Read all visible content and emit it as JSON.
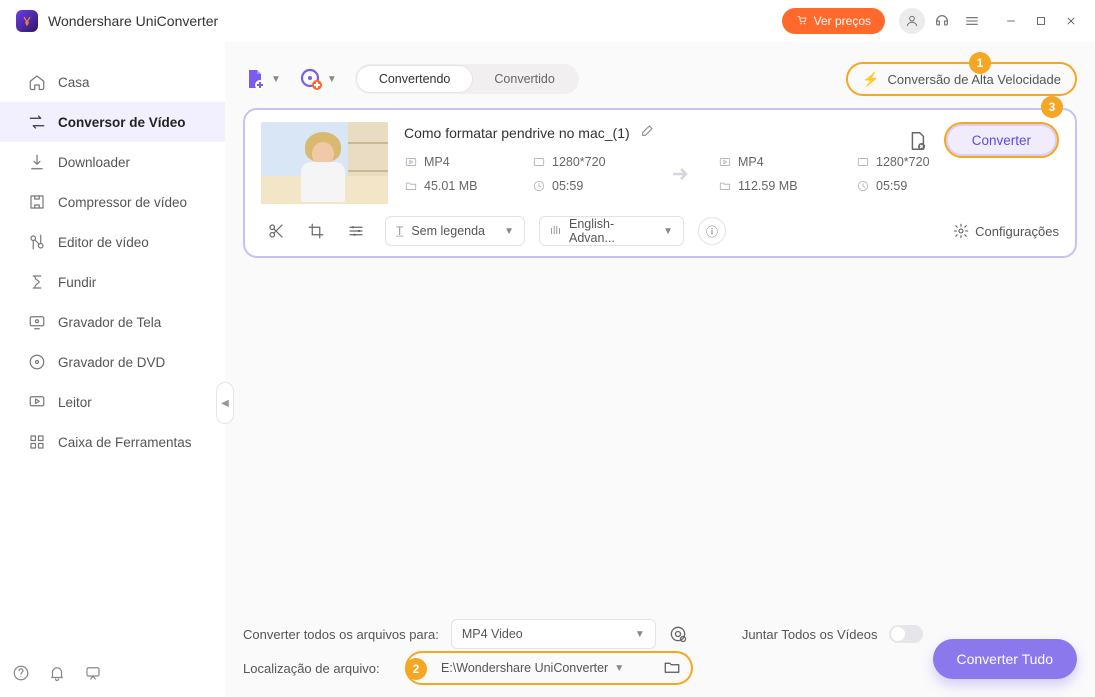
{
  "titlebar": {
    "app_name": "Wondershare UniConverter",
    "price_button": "Ver preços"
  },
  "sidebar": {
    "items": [
      {
        "label": "Casa"
      },
      {
        "label": "Conversor de Vídeo"
      },
      {
        "label": "Downloader"
      },
      {
        "label": "Compressor de vídeo"
      },
      {
        "label": "Editor de vídeo"
      },
      {
        "label": "Fundir"
      },
      {
        "label": "Gravador de Tela"
      },
      {
        "label": "Gravador de DVD"
      },
      {
        "label": "Leitor"
      },
      {
        "label": "Caixa de Ferramentas"
      }
    ]
  },
  "toolbar": {
    "tabs": {
      "converting": "Convertendo",
      "converted": "Convertido"
    },
    "hispeed_label": "Conversão de Alta Velocidade"
  },
  "callouts": {
    "one": "1",
    "two": "2",
    "three": "3"
  },
  "file": {
    "title": "Como formatar pendrive no mac_(1)",
    "src": {
      "format": "MP4",
      "resolution": "1280*720",
      "size": "45.01 MB",
      "duration": "05:59"
    },
    "dst": {
      "format": "MP4",
      "resolution": "1280*720",
      "size": "112.59 MB",
      "duration": "05:59"
    },
    "subtitle_dd": "Sem legenda",
    "audio_dd": "English-Advan...",
    "settings_label": "Configurações",
    "convert_button": "Converter"
  },
  "footer": {
    "convert_all_label": "Converter todos os arquivos para:",
    "convert_all_value": "MP4 Video",
    "merge_label": "Juntar Todos os Vídeos",
    "location_label": "Localização de arquivo:",
    "location_value": "E:\\Wondershare UniConverter",
    "convert_all_button": "Converter Tudo"
  }
}
